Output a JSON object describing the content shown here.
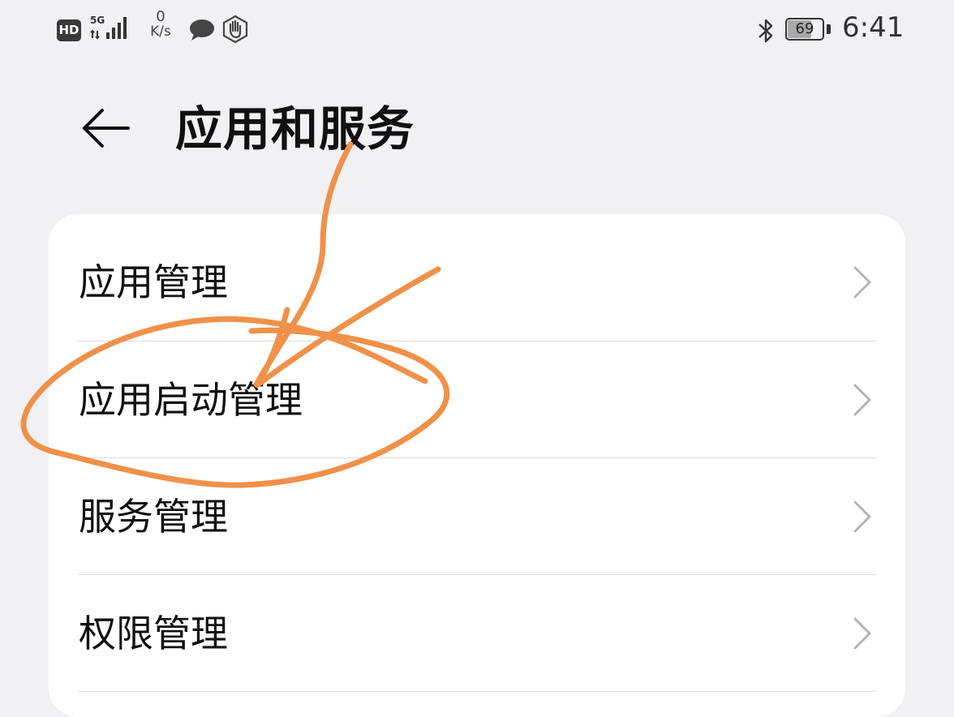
{
  "status_bar": {
    "hd_label": "HD",
    "network_type": "5G",
    "net_speed_value": "0",
    "net_speed_unit": "K/s",
    "battery_level": "69",
    "battery_fraction": 0.69,
    "time": "6:41",
    "icons": [
      "hd-icon",
      "signal-5g-icon",
      "chat-icon",
      "hand-icon",
      "bluetooth-icon",
      "battery-icon"
    ]
  },
  "header": {
    "title": "应用和服务",
    "back_icon": "back-arrow-icon"
  },
  "menu": {
    "items": [
      {
        "label": "应用管理"
      },
      {
        "label": "应用启动管理"
      },
      {
        "label": "服务管理"
      },
      {
        "label": "权限管理"
      }
    ],
    "chevron_icon": "chevron-right-icon"
  },
  "colors": {
    "background": "#f1f1f3",
    "card": "#ffffff",
    "annotation": "#f0914a",
    "chevron": "#b4b4b4"
  }
}
